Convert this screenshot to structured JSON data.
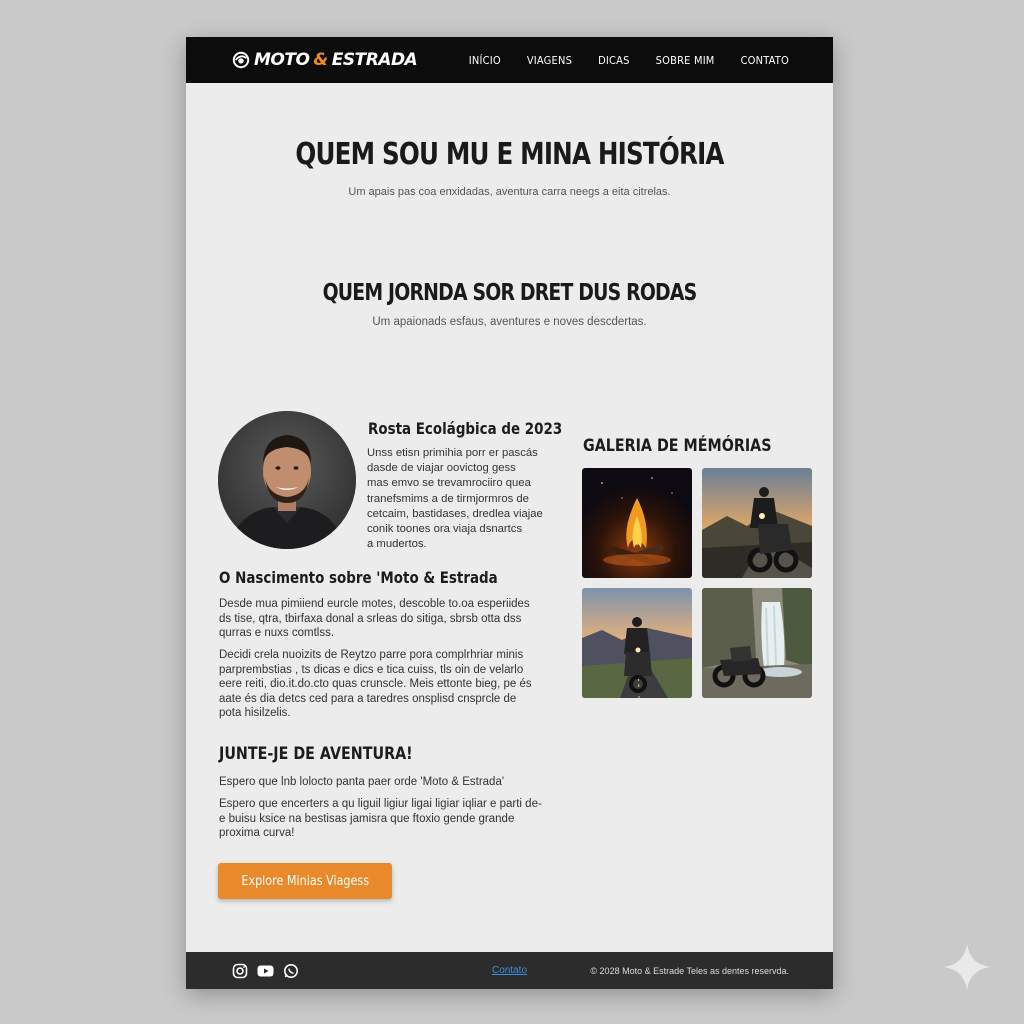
{
  "header": {
    "logo_text_moto": "MOTO",
    "logo_text_amp": "&",
    "logo_text_estrada": "ESTRADA",
    "nav": [
      "INÍCIO",
      "VIAGENS",
      "DICAS",
      "SOBRE MIM",
      "CONTATO"
    ]
  },
  "hero": {
    "title": "QUEM SOU MU E MINA HISTÓRIA",
    "subtitle": "Um apais pas coa enxidadas, aventura carra neegs a eita citrelas."
  },
  "section2": {
    "title": "QUEM JORNDA SOR DRET DUS RODAS",
    "subtitle": "Um apaionads esfaus, aventures e noves descdertas."
  },
  "profile": {
    "heading": "Rosta Ecolágbica de 2023",
    "lines": [
      "Unss etisn  primihia porr er pascás",
      "dasde de viajar oovictog gess",
      "mas emvo se trevamrociiro  quea",
      "tranefsmims a de tirmjormros de",
      "cetcaim, bastidases, dredlea viajae",
      "conik toones ora viaja dsnartcs",
      "a mudertos."
    ]
  },
  "nascimento": {
    "heading": "O Nascimento sobre 'Moto & Estrada",
    "para1": [
      "Desde mua pimiiend eurcle motes, descoble to.oa  esperiides",
      "ds tise, qtra, tbirfaxa donal a srleas do sitiga, sbrsb otta dss",
      "qurras e nuxs comtlss."
    ],
    "para2": [
      "Decidi crela nuoizits de Reytzo parre pora complrhriar minis",
      "parprembstias , ts dicas e dics e tica cuiss,  tls oin de velarlo",
      "eere reiti,  dio.it.do.cto quas crunscle.  Meis ettonte bieg,  pe és",
      "aate és dia detcs ced para a taredres onsplisd cnsprcle de",
      "pota hisilzelis."
    ]
  },
  "join": {
    "heading": "JUNTE-JE DE AVENTURA!",
    "para1": "Espero que lnb lolocto panta paer orde 'Moto & Estrada'",
    "para2": [
      "Espero que encerters a qu liguil ligiur ligai ligiar iqliar e parti  de-",
      "e buisu ksice na bestisas jamisra que ftoxio gende grande",
      "proxima curva!"
    ],
    "button": "Explore Minias Viagess"
  },
  "gallery": {
    "title": "GALERIA DE MÉMÓRIAS",
    "images": [
      "campfire-night",
      "rider-mountain-sunset",
      "rider-road-sunset",
      "motorcycle-waterfall"
    ]
  },
  "footer": {
    "icons": [
      "instagram-icon",
      "youtube-icon",
      "whatsapp-icon"
    ],
    "contact": "Contato",
    "copyright": "© 2028 Moto & Estrade  Teles as dentes reservda."
  },
  "colors": {
    "accent": "#e8892b",
    "header_bg": "#0c0c0c",
    "footer_bg": "#2c2c2c",
    "link": "#3b8fe0"
  }
}
